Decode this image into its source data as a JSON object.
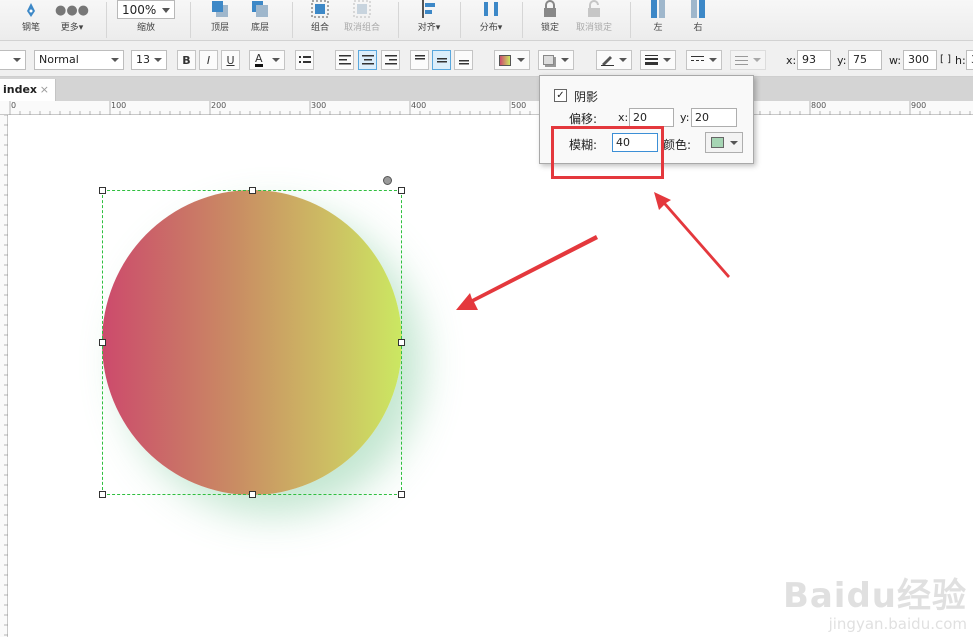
{
  "toolbar": {
    "pen_label": "钢笔",
    "more_label": "更多",
    "zoom_value": "100%",
    "zoom_label": "缩放",
    "top_layer_label": "顶层",
    "bottom_layer_label": "底层",
    "group_label": "组合",
    "ungroup_label": "取消组合",
    "align_label": "对齐",
    "distribute_label": "分布",
    "lock_label": "锁定",
    "unlock_label": "取消锁定",
    "left_label": "左",
    "right_label": "右"
  },
  "format_bar": {
    "style_value": "Normal",
    "font_size_value": "13",
    "bold": "B",
    "italic": "I",
    "underline": "U",
    "font_color_letter": "A",
    "x_label": "x:",
    "x_value": "93",
    "y_label": "y:",
    "y_value": "75",
    "w_label": "w:",
    "w_value": "300",
    "h_label": "h:",
    "h_value": "3"
  },
  "tabs": [
    {
      "label": "index",
      "close": "×"
    }
  ],
  "ruler_top": [
    "0",
    "100",
    "200",
    "300",
    "400",
    "500",
    "800",
    "900"
  ],
  "shadow_popup": {
    "enabled_check": "✓",
    "title": "阴影",
    "offset_label": "偏移:",
    "x_label": "x:",
    "x_value": "20",
    "y_label": "y:",
    "y_value": "20",
    "blur_label": "模糊:",
    "blur_value": "40",
    "color_label": "颜色:"
  },
  "colors": {
    "gradient_start": "#cc4a6c",
    "gradient_end": "#cbe862",
    "shadow_color": "#a6d5b4",
    "selection": "#2fbf3f",
    "annotation_red": "#e4383d"
  },
  "watermark": {
    "brand": "Baidu经验",
    "url": "jingyan.baidu.com"
  }
}
